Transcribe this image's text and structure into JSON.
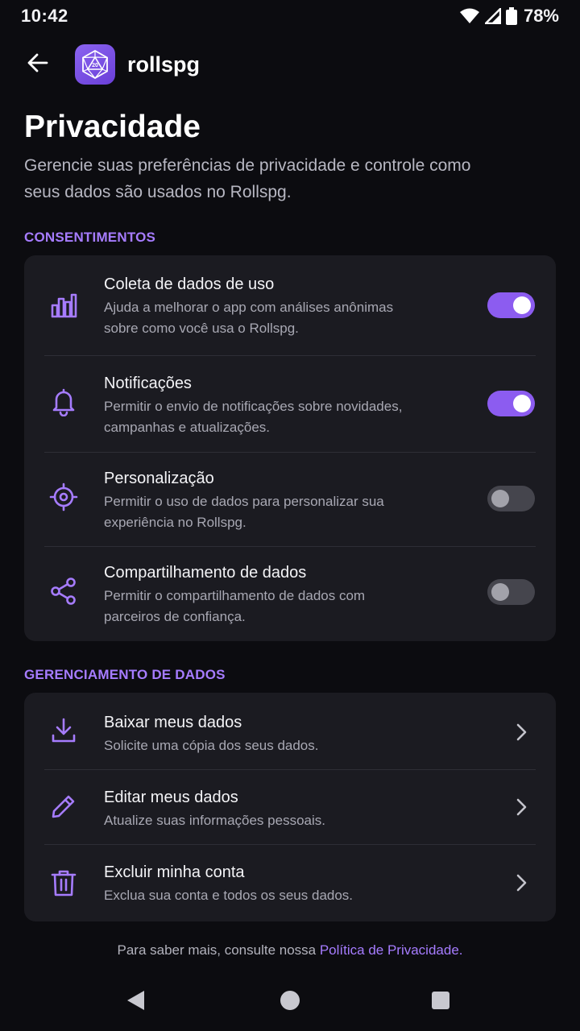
{
  "status_bar": {
    "time": "10:42",
    "battery": "78%"
  },
  "app_bar": {
    "app_name": "rollspg",
    "logo_text": "20"
  },
  "page": {
    "title": "Privacidade",
    "subtitle": "Gerencie suas preferências de privacidade e controle como seus dados são usados no Rollspg."
  },
  "consent": {
    "section_label": "CONSENTIMENTOS",
    "items": [
      {
        "icon": "bar-chart-icon",
        "title": "Coleta de dados de uso",
        "description": "Ajuda a melhorar o app com análises anônimas sobre como você usa o Rollspg.",
        "enabled": true
      },
      {
        "icon": "bell-icon",
        "title": "Notificações",
        "description": "Permitir o envio de notificações sobre novidades, campanhas e atualizações.",
        "enabled": true
      },
      {
        "icon": "target-icon",
        "title": "Personalização",
        "description": "Permitir o uso de dados para personalizar sua experiência no Rollspg.",
        "enabled": false
      },
      {
        "icon": "share-icon",
        "title": "Compartilhamento de dados",
        "description": "Permitir o compartilhamento de dados com parceiros de confiança.",
        "enabled": false
      }
    ]
  },
  "data_management": {
    "section_label": "GERENCIAMENTO DE DADOS",
    "items": [
      {
        "icon": "download-icon",
        "title": "Baixar meus dados",
        "description": "Solicite uma cópia dos seus dados."
      },
      {
        "icon": "pencil-icon",
        "title": "Editar meus dados",
        "description": "Atualize suas informações pessoais."
      },
      {
        "icon": "trash-icon",
        "title": "Excluir minha conta",
        "description": "Exclua sua conta e todos os seus dados."
      }
    ]
  },
  "footer": {
    "text": "Para saber mais, consulte nossa ",
    "link": "Política de Privacidade."
  },
  "colors": {
    "accent": "#a67cff",
    "toggle_on": "#8c5cf0",
    "background": "#0c0c10",
    "card": "#1b1b21"
  }
}
